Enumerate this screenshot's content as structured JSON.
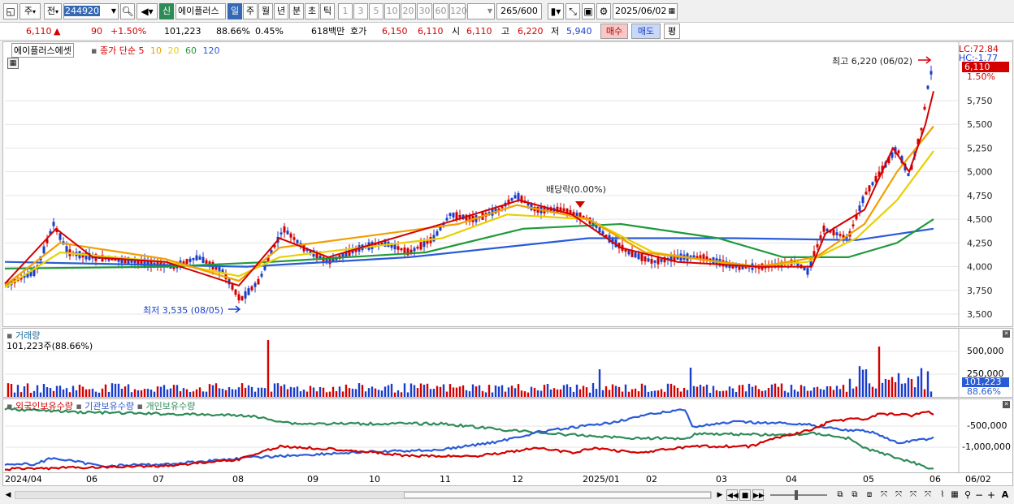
{
  "toolbar": {
    "type_label": "주",
    "prefix_label": "전",
    "code_value": "244920",
    "new_tag": "신",
    "stock_name": "에이플러스",
    "periods": [
      "일",
      "주",
      "월",
      "년",
      "분",
      "초",
      "틱"
    ],
    "active_period": "일",
    "intervals": [
      "1",
      "3",
      "5",
      "10",
      "20",
      "30",
      "60",
      "120"
    ],
    "count_value": "265",
    "count_total": "/600",
    "date_value": "2025/06/02"
  },
  "quote": {
    "price": "6,110",
    "arrow": "▲",
    "change": "90",
    "change_pct": "+1.50%",
    "volume": "101,223",
    "volume_ratio": "88.66%",
    "turnover": "0.45%",
    "amount": "618백만",
    "hoga_label": "호가",
    "hoga_ask": "6,150",
    "hoga_bid": "6,110",
    "open_label": "시",
    "open": "6,110",
    "high_label": "고",
    "high": "6,220",
    "low_label": "저",
    "low": "5,940",
    "buy_label": "매수",
    "sell_label": "매도",
    "avg_label": "평"
  },
  "price_pane": {
    "legend_name": "에이플러스에셋",
    "legend_ma_label": "종가 단순",
    "ma_periods": [
      "5",
      "10",
      "20",
      "60",
      "120"
    ],
    "ma_colors": [
      "#d40000",
      "#f0a000",
      "#e8d000",
      "#1e9a3a",
      "#2a5bd7"
    ],
    "lc_label": "LC:72.84",
    "hc_label": "HC:-1.77",
    "last_price_label": "6,110",
    "last_pct_label": "1.50%",
    "high_annotation": "최고 6,220 (06/02)",
    "low_annotation": "최저 3,535 (08/05)",
    "dividend_annotation": "배당락(0.00%)",
    "y_ticks": [
      "5,750",
      "5,500",
      "5,250",
      "5,000",
      "4,750",
      "4,500",
      "4,250",
      "4,000",
      "3,750",
      "3,500"
    ]
  },
  "volume_pane": {
    "title": "거래량",
    "value_label": "101,223주(88.66%)",
    "y_ticks": [
      "500,000",
      "250,000"
    ],
    "last_label": "101,223",
    "last_pct": "88.66%"
  },
  "holdings_pane": {
    "series": [
      "외국인보유수량",
      "기관보유수량",
      "개인보유수량"
    ],
    "series_colors": [
      "#d40000",
      "#2a5bd7",
      "#2e8b57"
    ],
    "y_ticks": [
      "-500,000",
      "-1,000,000"
    ]
  },
  "x_axis": {
    "labels": [
      "2024/04",
      "06",
      "07",
      "08",
      "09",
      "10",
      "11",
      "12",
      "2025/01",
      "02",
      "03",
      "04",
      "05",
      "06",
      "06/02"
    ]
  }
}
